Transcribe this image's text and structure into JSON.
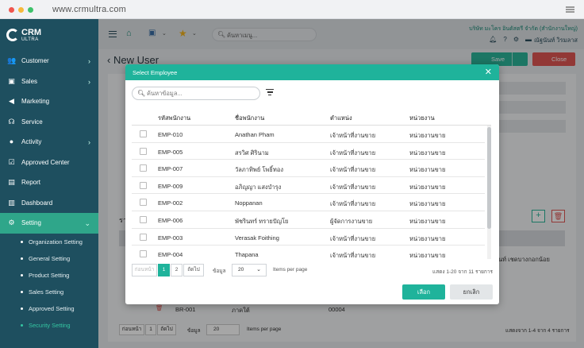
{
  "browser": {
    "url": "www.crmultra.com"
  },
  "logo": {
    "name": "CRM",
    "sub": "ULTRA"
  },
  "sidebar": {
    "items": [
      {
        "label": "Customer",
        "icon": "users-icon",
        "chevron": ">"
      },
      {
        "label": "Sales",
        "icon": "briefcase-icon",
        "chevron": ">"
      },
      {
        "label": "Marketing",
        "icon": "megaphone-icon",
        "chevron": ""
      },
      {
        "label": "Service",
        "icon": "headset-icon",
        "chevron": ""
      },
      {
        "label": "Activity",
        "icon": "chat-icon",
        "chevron": ">"
      },
      {
        "label": "Approved Center",
        "icon": "check-square-icon",
        "chevron": ""
      },
      {
        "label": "Report",
        "icon": "file-icon",
        "chevron": ""
      },
      {
        "label": "Dashboard",
        "icon": "chart-icon",
        "chevron": ""
      },
      {
        "label": "Setting",
        "icon": "gear-icon",
        "chevron": "v"
      }
    ],
    "submenu": [
      "Organization Setting",
      "General Setting",
      "Product Setting",
      "Sales Setting",
      "Approved Setting",
      "Security Setting"
    ]
  },
  "header": {
    "search_placeholder": "ค้นหาเมนู...",
    "company": "บริษัท มะโคร อินดัสตรี จำกัด (สำนักงานใหญ่)",
    "user": "ณัฐนันท์ วิรมลาส"
  },
  "page": {
    "title": "New User",
    "save_label": "Save",
    "close_label": "Close",
    "bg_rows": [
      {
        "code": "BR-001",
        "name": "ภาคใต้",
        "ref": "00004"
      }
    ],
    "bg_right_text": "นท์ เชดบางกอกน้อย",
    "bg_pager": {
      "prev": "ก่อนหน้า",
      "page": "1",
      "next": "ถัดไป",
      "rows_label": "ข้อมูล",
      "rows_value": "20",
      "per_page": "Items per page",
      "summary": "แสดงจาก 1-4 จาก 4 รายการ"
    },
    "bg_section_prefix": "รา"
  },
  "modal": {
    "title": "Select Employee",
    "search_placeholder": "ค้นหาข้อมูล...",
    "columns": [
      "รหัสพนักงาน",
      "ชื่อพนักงาน",
      "ตำแหน่ง",
      "หน่วยงาน"
    ],
    "rows": [
      [
        "EMP-010",
        "Anathan Pham",
        "เจ้าหน้าที่งานขาย",
        "หน่วยงานขาย"
      ],
      [
        "EMP-005",
        "สรวิศ ศิรินาม",
        "เจ้าหน้าที่งานขาย",
        "หน่วยงานขาย"
      ],
      [
        "EMP-007",
        "วัลภาทิพย์ โพธิ์ทอง",
        "เจ้าหน้าที่งานขาย",
        "หน่วยงานขาย"
      ],
      [
        "EMP-009",
        "อภิญญา แสงบำรุง",
        "เจ้าหน้าที่งานขาย",
        "หน่วยงานขาย"
      ],
      [
        "EMP-002",
        "Noppanan",
        "เจ้าหน้าที่งานขาย",
        "หน่วยงานขาย"
      ],
      [
        "EMP-006",
        "พัชรินทร์ ทรายปัญโย",
        "ผู้จัดการงานขาย",
        "หน่วยงานขาย"
      ],
      [
        "EMP-003",
        "Verasak Foithing",
        "เจ้าหน้าที่งานขาย",
        "หน่วยงานขาย"
      ],
      [
        "EMP-004",
        "Thapana",
        "เจ้าหน้าที่งานขาย",
        "หน่วยงานขาย"
      ]
    ],
    "pager": {
      "prev": "ก่อนหน้า",
      "pages": [
        "1",
        "2"
      ],
      "next": "ถัดไป",
      "rows_label": "ข้อมูล",
      "rows_value": "20",
      "per_page": "Items per page",
      "summary": "แสดง 1-20 จาก 11 รายการ"
    },
    "ok_label": "เลือก",
    "cancel_label": "ยกเลิก"
  },
  "colors": {
    "sidebar": "#1e4f5f",
    "accent": "#1fb39b",
    "danger": "#e05654"
  }
}
